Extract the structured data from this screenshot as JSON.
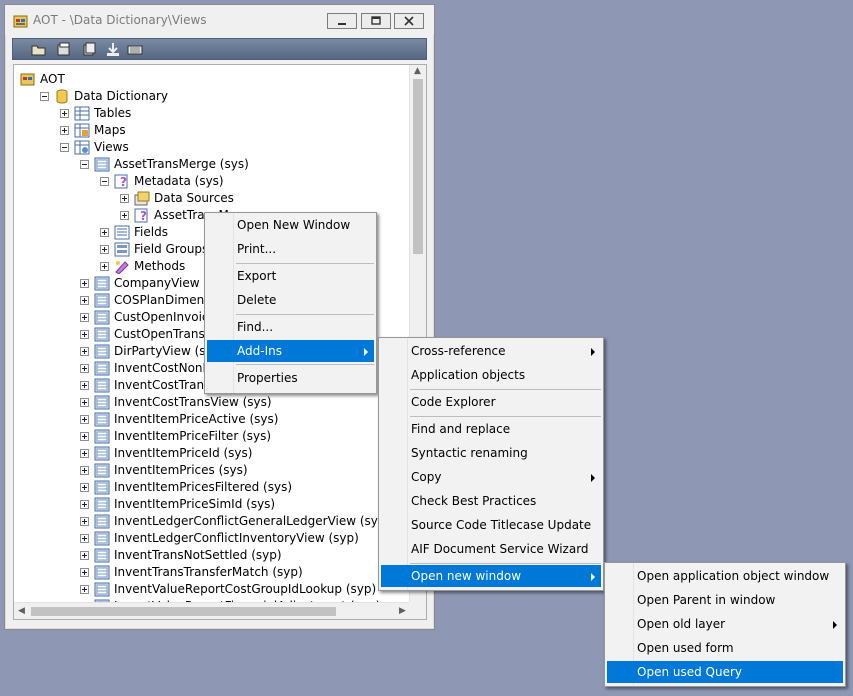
{
  "window": {
    "title": "AOT - \\Data Dictionary\\Views",
    "minimize_icon": "minimize-icon",
    "maximize_icon": "maximize-icon",
    "close_icon": "close-icon"
  },
  "toolbar": {
    "icons": [
      "open-folder-icon",
      "properties-icon",
      "compile-icon",
      "import-icon",
      "layer-icon"
    ]
  },
  "tree": {
    "nodes": [
      {
        "label": "AOT",
        "icon": "aot-icon",
        "expander": "none"
      },
      {
        "label": "Data Dictionary",
        "icon": "database-icon",
        "expander": "minus"
      },
      {
        "label": "Tables",
        "icon": "tables-icon",
        "expander": "plus"
      },
      {
        "label": "Maps",
        "icon": "maps-icon",
        "expander": "plus"
      },
      {
        "label": "Views",
        "icon": "views-icon",
        "expander": "minus"
      },
      {
        "label": "AssetTransMerge (sys)",
        "icon": "view-icon",
        "expander": "minus"
      },
      {
        "label": "Metadata (sys)",
        "icon": "query-icon",
        "expander": "minus"
      },
      {
        "label": "Data Sources",
        "icon": "datasources-icon",
        "expander": "plus"
      },
      {
        "label": "AssetTransMerge",
        "icon": "query-icon",
        "expander": "plus"
      },
      {
        "label": "Fields",
        "icon": "fields-icon",
        "expander": "plus"
      },
      {
        "label": "Field Groups",
        "icon": "fieldgroups-icon",
        "expander": "plus"
      },
      {
        "label": "Methods",
        "icon": "methods-icon",
        "expander": "plus"
      },
      {
        "label": "CompanyView (sys)",
        "icon": "view-icon",
        "expander": "plus"
      },
      {
        "label": "COSPlanDimensions",
        "icon": "view-icon",
        "expander": "plus"
      },
      {
        "label": "CustOpenInvoices (s",
        "icon": "view-icon",
        "expander": "plus"
      },
      {
        "label": "CustOpenTransWithI",
        "icon": "view-icon",
        "expander": "plus"
      },
      {
        "label": "DirPartyView (sys)",
        "icon": "view-icon",
        "expander": "plus"
      },
      {
        "label": "InventCostNonFinTra",
        "icon": "view-icon",
        "expander": "plus"
      },
      {
        "label": "InventCostTransItem",
        "icon": "view-icon",
        "expander": "plus"
      },
      {
        "label": "InventCostTransView (sys)",
        "icon": "view-icon",
        "expander": "plus"
      },
      {
        "label": "InventItemPriceActive (sys)",
        "icon": "view-icon",
        "expander": "plus"
      },
      {
        "label": "InventItemPriceFilter (sys)",
        "icon": "view-icon",
        "expander": "plus"
      },
      {
        "label": "InventItemPriceId (sys)",
        "icon": "view-icon",
        "expander": "plus"
      },
      {
        "label": "InventItemPrices (sys)",
        "icon": "view-icon",
        "expander": "plus"
      },
      {
        "label": "InventItemPricesFiltered (sys)",
        "icon": "view-icon",
        "expander": "plus"
      },
      {
        "label": "InventItemPriceSimId (sys)",
        "icon": "view-icon",
        "expander": "plus"
      },
      {
        "label": "InventLedgerConflictGeneralLedgerView (syp)",
        "icon": "view-icon",
        "expander": "plus"
      },
      {
        "label": "InventLedgerConflictInventoryView (syp)",
        "icon": "view-icon",
        "expander": "plus"
      },
      {
        "label": "InventTransNotSettled (syp)",
        "icon": "view-icon",
        "expander": "plus"
      },
      {
        "label": "InventTransTransferMatch (syp)",
        "icon": "view-icon",
        "expander": "plus"
      },
      {
        "label": "InventValueReportCostGroupIdLookup (syp)",
        "icon": "view-icon",
        "expander": "plus"
      },
      {
        "label": "InventValueReportFinancialAdjustment (syp)",
        "icon": "view-icon",
        "expander": "plus"
      }
    ]
  },
  "context_menu": {
    "items": [
      {
        "label": "Open New Window"
      },
      {
        "label": "Print..."
      },
      {
        "label": "Export"
      },
      {
        "label": "Delete"
      },
      {
        "label": "Find..."
      },
      {
        "label": "Add-Ins",
        "submenu": true,
        "highlighted": true
      },
      {
        "label": "Properties"
      }
    ]
  },
  "addins_menu": {
    "items": [
      {
        "label": "Cross-reference",
        "submenu": true
      },
      {
        "label": "Application objects"
      },
      {
        "label": "Code Explorer"
      },
      {
        "label": "Find and replace"
      },
      {
        "label": "Syntactic renaming"
      },
      {
        "label": "Copy",
        "submenu": true
      },
      {
        "label": "Check Best Practices"
      },
      {
        "label": "Source Code Titlecase Update"
      },
      {
        "label": "AIF Document Service Wizard"
      },
      {
        "label": "Open new window",
        "submenu": true,
        "highlighted": true
      }
    ]
  },
  "openwin_menu": {
    "items": [
      {
        "label": "Open application object window"
      },
      {
        "label": "Open Parent in window"
      },
      {
        "label": "Open old layer",
        "submenu": true
      },
      {
        "label": "Open used form"
      },
      {
        "label": "Open used Query",
        "highlighted": true
      }
    ]
  },
  "colors": {
    "desktop": "#8e98b4",
    "highlight": "#0078d7",
    "toolbar": "#5d6e89"
  }
}
